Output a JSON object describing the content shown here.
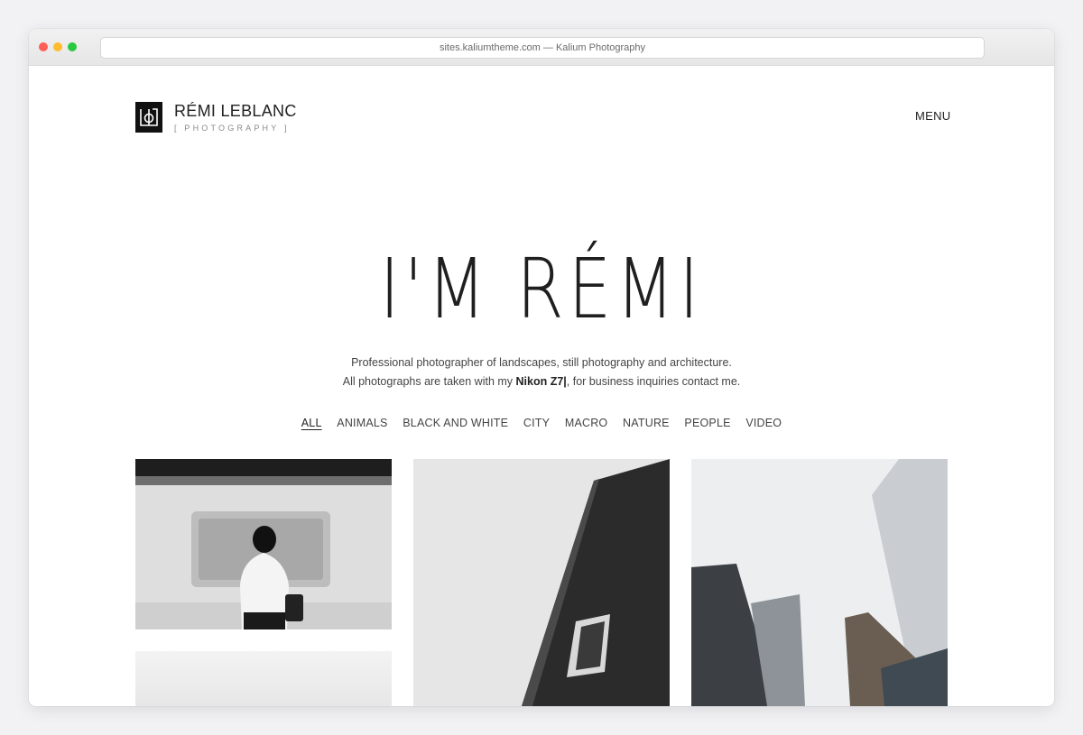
{
  "browser": {
    "url_title": "sites.kaliumtheme.com — Kalium Photography"
  },
  "header": {
    "logo_name": "RÉMI LEBLANC",
    "logo_subtitle": "[ PHOTOGRAPHY ]",
    "menu_label": "MENU"
  },
  "hero": {
    "title": "I'M RÉMI",
    "line1": "Professional photographer of landscapes, still photography and architecture.",
    "line2_prefix": "All photographs are taken with my ",
    "camera": "Nikon Z7|",
    "line2_suffix": ", for business inquiries contact me."
  },
  "filters": {
    "items": [
      "ALL",
      "ANIMALS",
      "BLACK AND WHITE",
      "CITY",
      "MACRO",
      "NATURE",
      "PEOPLE",
      "VIDEO"
    ],
    "active": "ALL"
  },
  "colors": {
    "background": "#f2f2f4",
    "text": "#222222",
    "muted": "#8a8a8a"
  }
}
